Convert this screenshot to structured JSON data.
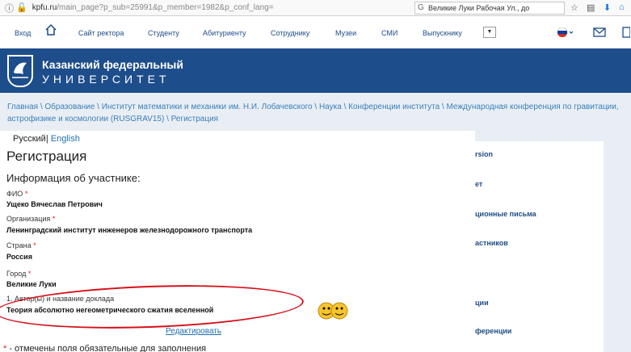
{
  "browser": {
    "url_host": "kpfu.ru",
    "url_path": "/main_page?p_sub=25991&p_member=1982&p_conf_lang=",
    "search_text": "Великие Луки Рабочая Ул., до"
  },
  "topnav": {
    "items": [
      "Вход",
      "Сайт ректора",
      "Студенту",
      "Абитуриенту",
      "Сотруднику",
      "Музеи",
      "СМИ",
      "Выпускнику"
    ]
  },
  "header": {
    "line1": "Казанский федеральный",
    "line2": "УНИВЕРСИТЕТ"
  },
  "breadcrumb": "Главная \\ Образование \\ Институт математики и механики им. Н.И. Лобачевского \\ Наука \\ Конференции института \\ Международная конференция по гравитации, астрофизике и космологии (RUSGRAV15) \\ Регистрация",
  "lang": {
    "current": "Русский",
    "separator": "|",
    "other": "English"
  },
  "page": {
    "title": "Регистрация",
    "section": "Информация об участнике:",
    "fields": [
      {
        "label": "ФИО",
        "required": "*",
        "value": "Ущеко Вячеслав Петрович"
      },
      {
        "label": "Организация",
        "required": "*",
        "value": "Ленинградский институт инженеров железнодорожного транспорта"
      },
      {
        "label": "Страна",
        "required": "*",
        "value": "Россия"
      },
      {
        "label": "Город",
        "required": "*",
        "value": "Великие Луки"
      },
      {
        "label": "1. Автор(ы) и название доклада",
        "required": "",
        "value": "Теория абсолютно негеометрического сжатия вселенной"
      }
    ],
    "edit_link": "Редактировать",
    "note_star": "*",
    "note_text": " - отмечены поля обязательные для заполнения"
  },
  "sidebar": {
    "items": [
      "rsion",
      "ет",
      "ционные письма",
      "астников",
      "",
      "ции",
      "ференции"
    ]
  }
}
